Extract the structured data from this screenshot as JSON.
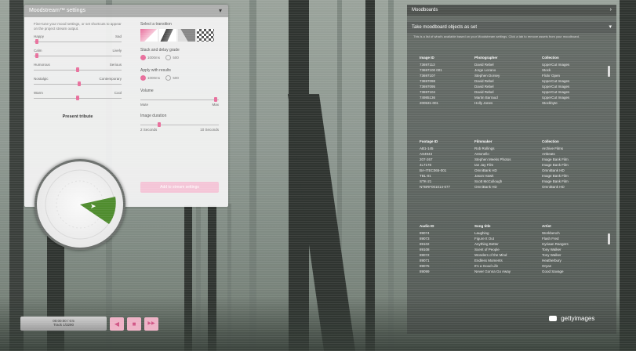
{
  "settings_panel": {
    "title": "Moodstream™ settings",
    "intro": "Fine-tune your mood settings, or set shortcuts to appear on the project stream output.",
    "sliders": [
      {
        "left": "Happy",
        "right": "Sad"
      },
      {
        "left": "Calm",
        "right": "Lively"
      },
      {
        "left": "Humorous",
        "right": "Serious"
      },
      {
        "left": "Nostalgic",
        "right": "Contemporary"
      },
      {
        "left": "Warm",
        "right": "Cool"
      }
    ],
    "dial_label": "Present tribute",
    "select_transition": "Select a transition",
    "stack_label": "Stack and delay grade",
    "stack_options": [
      "1000ms",
      "500"
    ],
    "apply_label": "Apply with results",
    "apply_options": [
      "1000ms",
      "500"
    ],
    "volume_label": "Volume",
    "volume_min": "Mute",
    "volume_max": "Max",
    "image_duration_label": "Image duration",
    "duration_min": "2 Seconds",
    "duration_max": "10 Seconds",
    "action_button": "Add to stream settings"
  },
  "right_panel": {
    "header": "Moodboards",
    "subheader": "Take moodboard objects as set",
    "description": "This is a list of what's available based on your Moodstream settings. Click a tab to remove assets from your moodboard.",
    "images": {
      "headers": [
        "Image ID",
        "Photographer",
        "Collection"
      ],
      "rows": [
        [
          "73697113",
          "David Rebel",
          "UpperCut Images"
        ],
        [
          "73697100 001",
          "Jorge Lozano",
          "Stock"
        ],
        [
          "73697107",
          "Stephen Dorsey",
          "Flickr Open"
        ],
        [
          "73697098",
          "David Rebel",
          "UpperCut Images"
        ],
        [
          "73697095",
          "David Rebel",
          "UpperCut Images"
        ],
        [
          "73697104",
          "David Rebel",
          "UpperCut Images"
        ],
        [
          "74985136",
          "Martin Barraud",
          "UpperCut Images"
        ],
        [
          "200531-001",
          "Holly Jones",
          "Stockbyte"
        ]
      ]
    },
    "footage": {
      "headers": [
        "Footage ID",
        "Filmmaker",
        "Collection"
      ],
      "rows": [
        [
          "AB1-145",
          "Rob Rollings",
          "Archive Films"
        ],
        [
          "AS4943",
          "Antonello",
          "Artbeats"
        ],
        [
          "207-267",
          "Stephen Meeks Photos",
          "Image Bank Film"
        ],
        [
          "4L7178",
          "Ian Jay Film",
          "Image Bank Film"
        ],
        [
          "BA-ITEC065-001",
          "OmniBank HD",
          "OmniBank HD"
        ],
        [
          "TBL-01",
          "Jason Hawk",
          "Image Bank Film"
        ],
        [
          "STK-21",
          "Scott McCullough",
          "Image Bank Film"
        ],
        [
          "NTBRF001014-077",
          "OmniBank HD",
          "OmniBank HD"
        ]
      ]
    },
    "audio": {
      "headers": [
        "Audio ID",
        "Song title",
        "Artist"
      ],
      "rows": [
        [
          "89074",
          "Laughing",
          "Workbench"
        ],
        [
          "89073",
          "Figure It Out",
          "Flash Fred"
        ],
        [
          "89102",
          "Anything Better",
          "Hyriaan Rangers"
        ],
        [
          "89108",
          "Scent of People",
          "Tony Walker"
        ],
        [
          "89072",
          "Wonders of the Mind",
          "Tony Walker"
        ],
        [
          "89071",
          "Endless Moments",
          "Heatherbury"
        ],
        [
          "89075",
          "It's a Good Life",
          "Oryan"
        ],
        [
          "89099",
          "Never Gonna Go Away",
          "Good Savage"
        ]
      ]
    }
  },
  "player": {
    "line1": "00:00:00 / 0:5",
    "line2": "Track 1/3290",
    "buttons": [
      "◀",
      "■",
      "▶▶"
    ]
  },
  "brand": "gettyimages"
}
